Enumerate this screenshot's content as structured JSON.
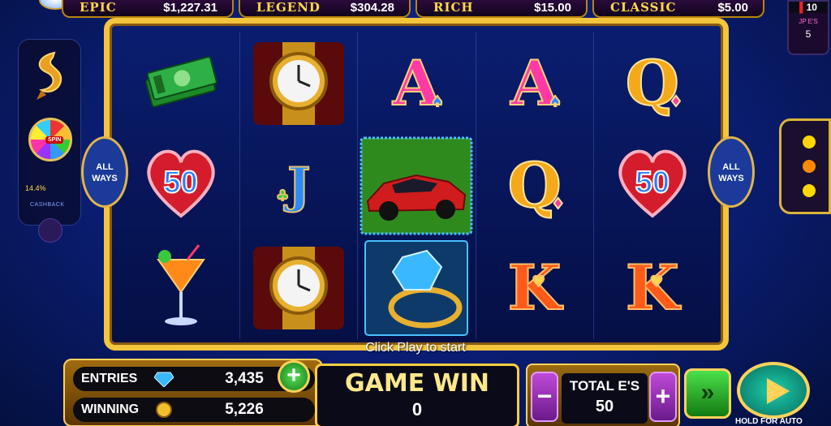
{
  "jackpots": [
    {
      "name": "EPIC",
      "value": "$1,227.31"
    },
    {
      "name": "LEGEND",
      "value": "$304.28"
    },
    {
      "name": "RICH",
      "value": "$15.00"
    },
    {
      "name": "CLASSIC",
      "value": "$5.00"
    }
  ],
  "jp_widget": {
    "top_value": "10",
    "label": "JP E'S",
    "count": "5"
  },
  "left_panel": {
    "spin_label": "SPIN",
    "percent": "14.4%",
    "cashback_label": "CASHBACK"
  },
  "ways_label_left": "ALL WAYS",
  "ways_label_right": "ALL WAYS",
  "reels": [
    [
      {
        "type": "icon",
        "name": "cash-stack-icon"
      },
      {
        "type": "heart",
        "value": "50"
      },
      {
        "type": "icon",
        "name": "cocktail-icon"
      }
    ],
    [
      {
        "type": "icon",
        "name": "gold-watch-icon"
      },
      {
        "type": "card",
        "letter": "J",
        "color": "blue",
        "suit": "♣"
      },
      {
        "type": "icon",
        "name": "gold-watch-icon"
      }
    ],
    [
      {
        "type": "icon",
        "name": "spade-icon",
        "letter": "A",
        "color": "pink",
        "suit": "♠"
      },
      {
        "type": "icon",
        "name": "sports-car-icon"
      },
      {
        "type": "icon",
        "name": "diamond-ring-icon"
      }
    ],
    [
      {
        "type": "card",
        "letter": "A",
        "color": "pink",
        "suit": "♠"
      },
      {
        "type": "card",
        "letter": "Q",
        "color": "gold",
        "suit": "♦"
      },
      {
        "type": "card",
        "letter": "K",
        "color": "orange",
        "suit": "♥"
      }
    ],
    [
      {
        "type": "card",
        "letter": "Q",
        "color": "gold",
        "suit": "♦"
      },
      {
        "type": "heart",
        "value": "50"
      },
      {
        "type": "card",
        "letter": "K",
        "color": "orange",
        "suit": "♥"
      }
    ]
  ],
  "hint": "Click Play to start",
  "stats": {
    "entries_label": "ENTRIES",
    "entries_value": "3,435",
    "winning_label": "WINNING",
    "winning_value": "5,226"
  },
  "game_win": {
    "label": "GAME WIN",
    "value": "0"
  },
  "total": {
    "label": "TOTAL E'S",
    "value": "50",
    "minus": "−",
    "plus": "+"
  },
  "fast_label": "»",
  "hold_label": "HOLD FOR AUTO",
  "colors": {
    "gold": "#f2c53c",
    "bg_blue": "#0b1f7a",
    "green": "#3cc83c"
  }
}
